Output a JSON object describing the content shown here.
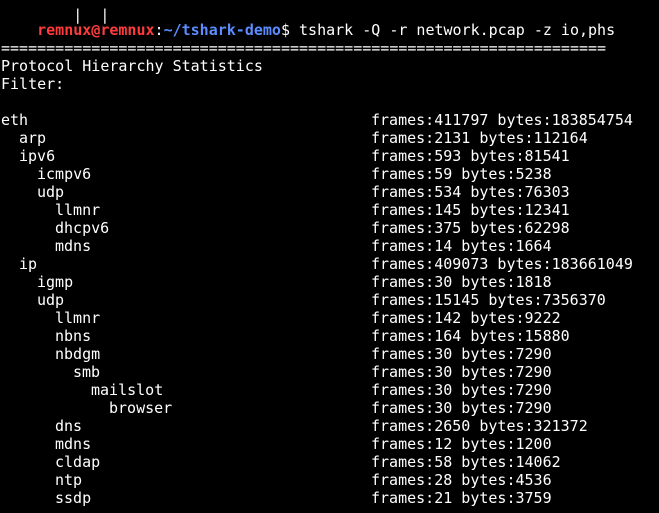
{
  "prompt": {
    "user_host": "remnux@remnux",
    "sep": ":",
    "path": "~/tshark-demo",
    "symbol": "$",
    "command": "tshark -Q -r network.pcap -z io,phs"
  },
  "header": {
    "separator": "===================================================================",
    "title": "Protocol Hierarchy Statistics",
    "filter": "Filter:"
  },
  "rows": [
    {
      "depth": 0,
      "proto": "eth",
      "stats": "frames:411797 bytes:183854754"
    },
    {
      "depth": 1,
      "proto": "arp",
      "stats": "frames:2131 bytes:112164"
    },
    {
      "depth": 1,
      "proto": "ipv6",
      "stats": "frames:593 bytes:81541"
    },
    {
      "depth": 2,
      "proto": "icmpv6",
      "stats": "frames:59 bytes:5238"
    },
    {
      "depth": 2,
      "proto": "udp",
      "stats": "frames:534 bytes:76303"
    },
    {
      "depth": 3,
      "proto": "llmnr",
      "stats": "frames:145 bytes:12341"
    },
    {
      "depth": 3,
      "proto": "dhcpv6",
      "stats": "frames:375 bytes:62298"
    },
    {
      "depth": 3,
      "proto": "mdns",
      "stats": "frames:14 bytes:1664"
    },
    {
      "depth": 1,
      "proto": "ip",
      "stats": "frames:409073 bytes:183661049"
    },
    {
      "depth": 2,
      "proto": "igmp",
      "stats": "frames:30 bytes:1818"
    },
    {
      "depth": 2,
      "proto": "udp",
      "stats": "frames:15145 bytes:7356370"
    },
    {
      "depth": 3,
      "proto": "llmnr",
      "stats": "frames:142 bytes:9222"
    },
    {
      "depth": 3,
      "proto": "nbns",
      "stats": "frames:164 bytes:15880"
    },
    {
      "depth": 3,
      "proto": "nbdgm",
      "stats": "frames:30 bytes:7290"
    },
    {
      "depth": 4,
      "proto": "smb",
      "stats": "frames:30 bytes:7290"
    },
    {
      "depth": 5,
      "proto": "mailslot",
      "stats": "frames:30 bytes:7290"
    },
    {
      "depth": 6,
      "proto": "browser",
      "stats": "frames:30 bytes:7290"
    },
    {
      "depth": 3,
      "proto": "dns",
      "stats": "frames:2650 bytes:321372"
    },
    {
      "depth": 3,
      "proto": "mdns",
      "stats": "frames:12 bytes:1200"
    },
    {
      "depth": 3,
      "proto": "cldap",
      "stats": "frames:58 bytes:14062"
    },
    {
      "depth": 3,
      "proto": "ntp",
      "stats": "frames:28 bytes:4536"
    },
    {
      "depth": 3,
      "proto": "ssdp",
      "stats": "frames:21 bytes:3759"
    }
  ],
  "colors": {
    "background": "#000000",
    "text": "#ffffff",
    "user_host": "#ff3b3b",
    "path": "#5c8cff"
  }
}
